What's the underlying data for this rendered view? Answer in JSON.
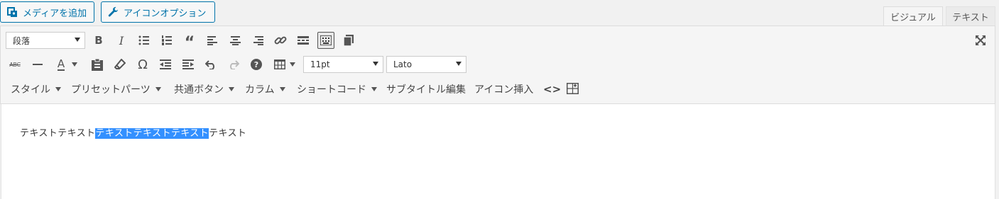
{
  "media_buttons": {
    "add_media": "メディアを追加",
    "icon_option": "アイコンオプション"
  },
  "tabs": {
    "visual": "ビジュアル",
    "text": "テキスト"
  },
  "toolbar": {
    "row1": {
      "format_select": "段落",
      "buttons": [
        "bold",
        "italic",
        "bullet-list",
        "numbered-list",
        "blockquote",
        "align-left",
        "align-center",
        "align-right",
        "link",
        "read-more",
        "toolbar-toggle",
        "copy"
      ],
      "bold_label": "B",
      "italic_label": "I"
    },
    "row2": {
      "font_size": "11pt",
      "font_family": "Lato",
      "strike_label": "ABC",
      "text_color_label": "A",
      "omega_label": "Ω",
      "help_label": "?"
    },
    "row3": {
      "style_menu": "スタイル",
      "preset_menu": "プリセットパーツ",
      "common_button_menu": "共通ボタン",
      "column_menu": "カラム",
      "shortcode_menu": "ショートコード",
      "subtitle_edit": "サブタイトル編集",
      "icon_insert": "アイコン挿入",
      "code_label": "<>"
    }
  },
  "editor": {
    "text_before": "テキストテキスト",
    "text_selected": "テキストテキストテキスト",
    "text_after": "テキスト"
  },
  "colors": {
    "accent": "#0073aa",
    "selection": "#3390ff"
  }
}
